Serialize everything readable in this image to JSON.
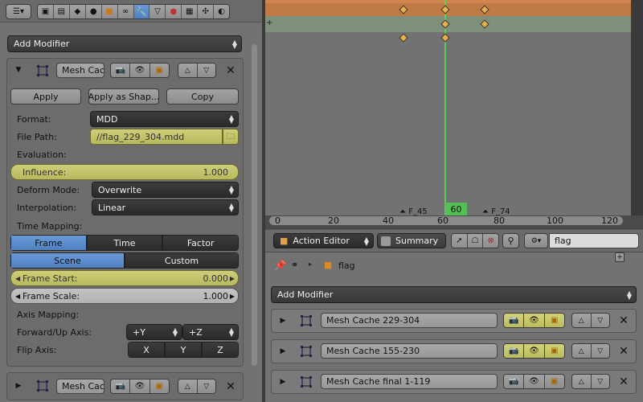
{
  "left": {
    "add_modifier": "Add Modifier",
    "modifier": {
      "name": "Mesh Cac",
      "apply": "Apply",
      "apply_shape": "Apply as Shap...",
      "copy": "Copy",
      "format_label": "Format:",
      "format_value": "MDD",
      "filepath_label": "File Path:",
      "filepath_value": "//flag_229_304.mdd",
      "evaluation_label": "Evaluation:",
      "influence_label": "Influence:",
      "influence_value": "1.000",
      "deform_label": "Deform Mode:",
      "deform_value": "Overwrite",
      "interp_label": "Interpolation:",
      "interp_value": "Linear",
      "timemapping_label": "Time Mapping:",
      "time_tabs": [
        "Frame",
        "Time",
        "Factor"
      ],
      "scene_tabs": [
        "Scene",
        "Custom"
      ],
      "frame_start_label": "Frame Start:",
      "frame_start_value": "0.000",
      "frame_scale_label": "Frame Scale:",
      "frame_scale_value": "1.000",
      "axis_mapping_label": "Axis Mapping:",
      "forward_label": "Forward/Up Axis:",
      "forward_value": "+Y",
      "up_value": "+Z",
      "flip_label": "Flip Axis:",
      "flip_x": "X",
      "flip_y": "Y",
      "flip_z": "Z"
    },
    "collapsed_modifier_name": "Mesh Cac"
  },
  "timeline": {
    "current_frame": "60",
    "marker_left": "F_45",
    "marker_right": "F_74",
    "ticks": [
      "0",
      "20",
      "40",
      "60",
      "80",
      "100",
      "120"
    ]
  },
  "action_header": {
    "editor": "Action Editor",
    "summary": "Summary",
    "search_value": "flag"
  },
  "right": {
    "breadcrumb_object": "flag",
    "add_modifier": "Add Modifier",
    "modifiers": [
      {
        "name": "Mesh Cache 229-304"
      },
      {
        "name": "Mesh Cache 155-230"
      },
      {
        "name": "Mesh Cache final 1-119"
      }
    ]
  },
  "colors": {
    "accent_blue": "#5a8bcd",
    "highlight_yellow": "#c8c86c",
    "playhead_green": "#55d055",
    "keyframe": "#e8b04a"
  }
}
